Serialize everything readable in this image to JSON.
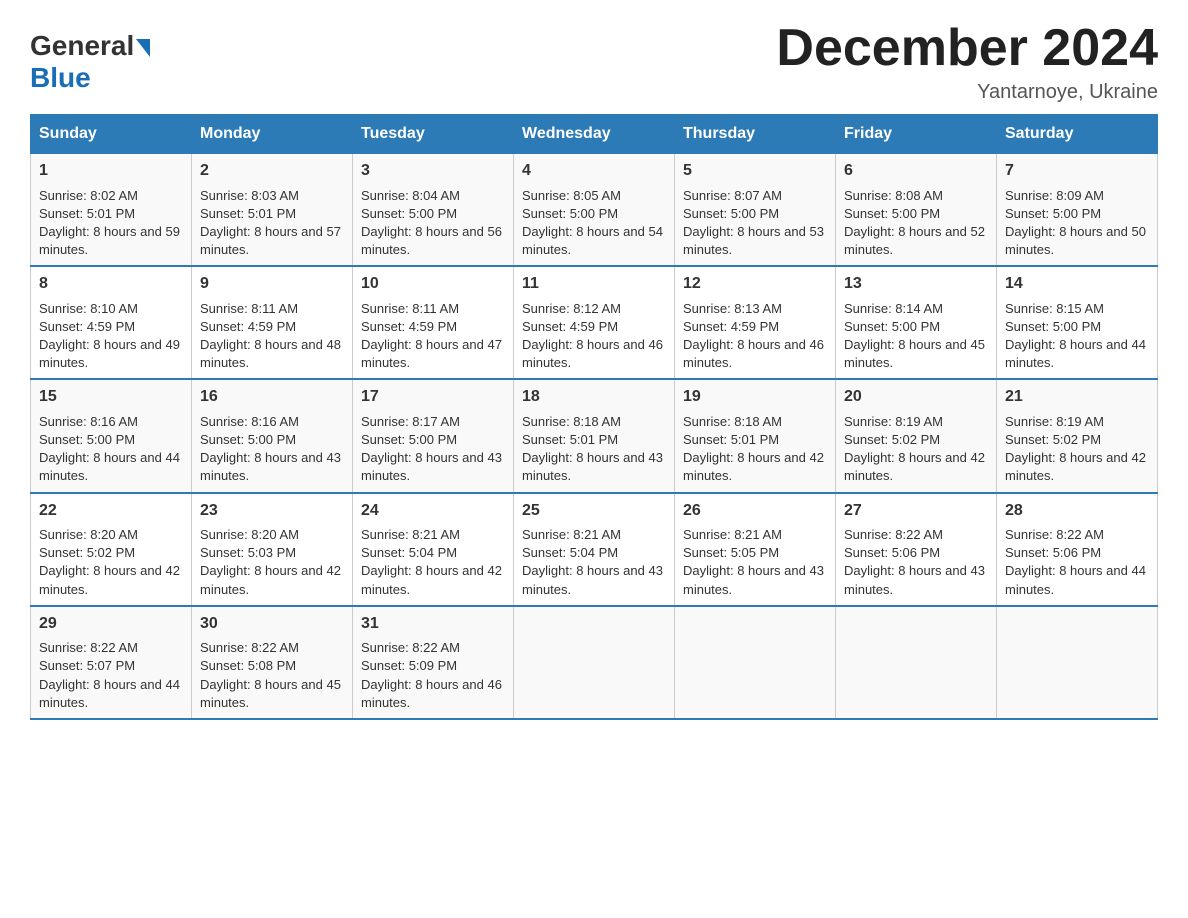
{
  "header": {
    "logo_general": "General",
    "logo_blue": "Blue",
    "month_title": "December 2024",
    "location": "Yantarnoye, Ukraine"
  },
  "days_of_week": [
    "Sunday",
    "Monday",
    "Tuesday",
    "Wednesday",
    "Thursday",
    "Friday",
    "Saturday"
  ],
  "weeks": [
    [
      {
        "day": "1",
        "sunrise": "Sunrise: 8:02 AM",
        "sunset": "Sunset: 5:01 PM",
        "daylight": "Daylight: 8 hours and 59 minutes."
      },
      {
        "day": "2",
        "sunrise": "Sunrise: 8:03 AM",
        "sunset": "Sunset: 5:01 PM",
        "daylight": "Daylight: 8 hours and 57 minutes."
      },
      {
        "day": "3",
        "sunrise": "Sunrise: 8:04 AM",
        "sunset": "Sunset: 5:00 PM",
        "daylight": "Daylight: 8 hours and 56 minutes."
      },
      {
        "day": "4",
        "sunrise": "Sunrise: 8:05 AM",
        "sunset": "Sunset: 5:00 PM",
        "daylight": "Daylight: 8 hours and 54 minutes."
      },
      {
        "day": "5",
        "sunrise": "Sunrise: 8:07 AM",
        "sunset": "Sunset: 5:00 PM",
        "daylight": "Daylight: 8 hours and 53 minutes."
      },
      {
        "day": "6",
        "sunrise": "Sunrise: 8:08 AM",
        "sunset": "Sunset: 5:00 PM",
        "daylight": "Daylight: 8 hours and 52 minutes."
      },
      {
        "day": "7",
        "sunrise": "Sunrise: 8:09 AM",
        "sunset": "Sunset: 5:00 PM",
        "daylight": "Daylight: 8 hours and 50 minutes."
      }
    ],
    [
      {
        "day": "8",
        "sunrise": "Sunrise: 8:10 AM",
        "sunset": "Sunset: 4:59 PM",
        "daylight": "Daylight: 8 hours and 49 minutes."
      },
      {
        "day": "9",
        "sunrise": "Sunrise: 8:11 AM",
        "sunset": "Sunset: 4:59 PM",
        "daylight": "Daylight: 8 hours and 48 minutes."
      },
      {
        "day": "10",
        "sunrise": "Sunrise: 8:11 AM",
        "sunset": "Sunset: 4:59 PM",
        "daylight": "Daylight: 8 hours and 47 minutes."
      },
      {
        "day": "11",
        "sunrise": "Sunrise: 8:12 AM",
        "sunset": "Sunset: 4:59 PM",
        "daylight": "Daylight: 8 hours and 46 minutes."
      },
      {
        "day": "12",
        "sunrise": "Sunrise: 8:13 AM",
        "sunset": "Sunset: 4:59 PM",
        "daylight": "Daylight: 8 hours and 46 minutes."
      },
      {
        "day": "13",
        "sunrise": "Sunrise: 8:14 AM",
        "sunset": "Sunset: 5:00 PM",
        "daylight": "Daylight: 8 hours and 45 minutes."
      },
      {
        "day": "14",
        "sunrise": "Sunrise: 8:15 AM",
        "sunset": "Sunset: 5:00 PM",
        "daylight": "Daylight: 8 hours and 44 minutes."
      }
    ],
    [
      {
        "day": "15",
        "sunrise": "Sunrise: 8:16 AM",
        "sunset": "Sunset: 5:00 PM",
        "daylight": "Daylight: 8 hours and 44 minutes."
      },
      {
        "day": "16",
        "sunrise": "Sunrise: 8:16 AM",
        "sunset": "Sunset: 5:00 PM",
        "daylight": "Daylight: 8 hours and 43 minutes."
      },
      {
        "day": "17",
        "sunrise": "Sunrise: 8:17 AM",
        "sunset": "Sunset: 5:00 PM",
        "daylight": "Daylight: 8 hours and 43 minutes."
      },
      {
        "day": "18",
        "sunrise": "Sunrise: 8:18 AM",
        "sunset": "Sunset: 5:01 PM",
        "daylight": "Daylight: 8 hours and 43 minutes."
      },
      {
        "day": "19",
        "sunrise": "Sunrise: 8:18 AM",
        "sunset": "Sunset: 5:01 PM",
        "daylight": "Daylight: 8 hours and 42 minutes."
      },
      {
        "day": "20",
        "sunrise": "Sunrise: 8:19 AM",
        "sunset": "Sunset: 5:02 PM",
        "daylight": "Daylight: 8 hours and 42 minutes."
      },
      {
        "day": "21",
        "sunrise": "Sunrise: 8:19 AM",
        "sunset": "Sunset: 5:02 PM",
        "daylight": "Daylight: 8 hours and 42 minutes."
      }
    ],
    [
      {
        "day": "22",
        "sunrise": "Sunrise: 8:20 AM",
        "sunset": "Sunset: 5:02 PM",
        "daylight": "Daylight: 8 hours and 42 minutes."
      },
      {
        "day": "23",
        "sunrise": "Sunrise: 8:20 AM",
        "sunset": "Sunset: 5:03 PM",
        "daylight": "Daylight: 8 hours and 42 minutes."
      },
      {
        "day": "24",
        "sunrise": "Sunrise: 8:21 AM",
        "sunset": "Sunset: 5:04 PM",
        "daylight": "Daylight: 8 hours and 42 minutes."
      },
      {
        "day": "25",
        "sunrise": "Sunrise: 8:21 AM",
        "sunset": "Sunset: 5:04 PM",
        "daylight": "Daylight: 8 hours and 43 minutes."
      },
      {
        "day": "26",
        "sunrise": "Sunrise: 8:21 AM",
        "sunset": "Sunset: 5:05 PM",
        "daylight": "Daylight: 8 hours and 43 minutes."
      },
      {
        "day": "27",
        "sunrise": "Sunrise: 8:22 AM",
        "sunset": "Sunset: 5:06 PM",
        "daylight": "Daylight: 8 hours and 43 minutes."
      },
      {
        "day": "28",
        "sunrise": "Sunrise: 8:22 AM",
        "sunset": "Sunset: 5:06 PM",
        "daylight": "Daylight: 8 hours and 44 minutes."
      }
    ],
    [
      {
        "day": "29",
        "sunrise": "Sunrise: 8:22 AM",
        "sunset": "Sunset: 5:07 PM",
        "daylight": "Daylight: 8 hours and 44 minutes."
      },
      {
        "day": "30",
        "sunrise": "Sunrise: 8:22 AM",
        "sunset": "Sunset: 5:08 PM",
        "daylight": "Daylight: 8 hours and 45 minutes."
      },
      {
        "day": "31",
        "sunrise": "Sunrise: 8:22 AM",
        "sunset": "Sunset: 5:09 PM",
        "daylight": "Daylight: 8 hours and 46 minutes."
      },
      null,
      null,
      null,
      null
    ]
  ]
}
